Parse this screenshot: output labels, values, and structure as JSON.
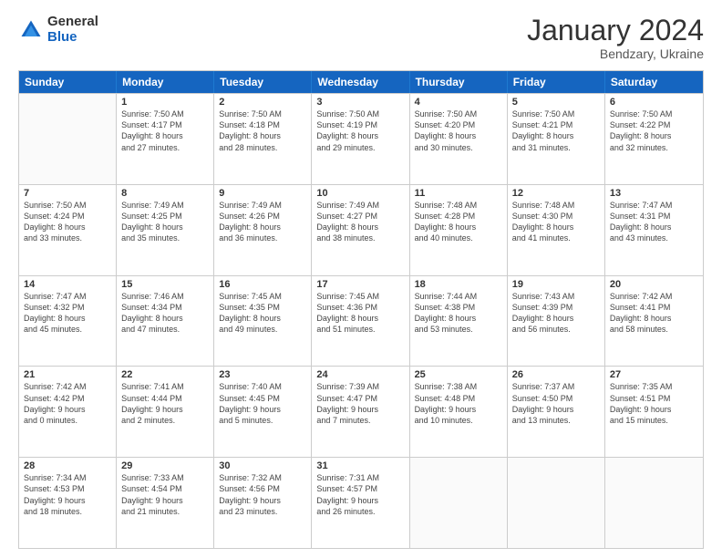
{
  "logo": {
    "general": "General",
    "blue": "Blue"
  },
  "title": "January 2024",
  "location": "Bendzary, Ukraine",
  "days_of_week": [
    "Sunday",
    "Monday",
    "Tuesday",
    "Wednesday",
    "Thursday",
    "Friday",
    "Saturday"
  ],
  "weeks": [
    [
      {
        "day": "",
        "lines": []
      },
      {
        "day": "1",
        "lines": [
          "Sunrise: 7:50 AM",
          "Sunset: 4:17 PM",
          "Daylight: 8 hours",
          "and 27 minutes."
        ]
      },
      {
        "day": "2",
        "lines": [
          "Sunrise: 7:50 AM",
          "Sunset: 4:18 PM",
          "Daylight: 8 hours",
          "and 28 minutes."
        ]
      },
      {
        "day": "3",
        "lines": [
          "Sunrise: 7:50 AM",
          "Sunset: 4:19 PM",
          "Daylight: 8 hours",
          "and 29 minutes."
        ]
      },
      {
        "day": "4",
        "lines": [
          "Sunrise: 7:50 AM",
          "Sunset: 4:20 PM",
          "Daylight: 8 hours",
          "and 30 minutes."
        ]
      },
      {
        "day": "5",
        "lines": [
          "Sunrise: 7:50 AM",
          "Sunset: 4:21 PM",
          "Daylight: 8 hours",
          "and 31 minutes."
        ]
      },
      {
        "day": "6",
        "lines": [
          "Sunrise: 7:50 AM",
          "Sunset: 4:22 PM",
          "Daylight: 8 hours",
          "and 32 minutes."
        ]
      }
    ],
    [
      {
        "day": "7",
        "lines": [
          "Sunrise: 7:50 AM",
          "Sunset: 4:24 PM",
          "Daylight: 8 hours",
          "and 33 minutes."
        ]
      },
      {
        "day": "8",
        "lines": [
          "Sunrise: 7:49 AM",
          "Sunset: 4:25 PM",
          "Daylight: 8 hours",
          "and 35 minutes."
        ]
      },
      {
        "day": "9",
        "lines": [
          "Sunrise: 7:49 AM",
          "Sunset: 4:26 PM",
          "Daylight: 8 hours",
          "and 36 minutes."
        ]
      },
      {
        "day": "10",
        "lines": [
          "Sunrise: 7:49 AM",
          "Sunset: 4:27 PM",
          "Daylight: 8 hours",
          "and 38 minutes."
        ]
      },
      {
        "day": "11",
        "lines": [
          "Sunrise: 7:48 AM",
          "Sunset: 4:28 PM",
          "Daylight: 8 hours",
          "and 40 minutes."
        ]
      },
      {
        "day": "12",
        "lines": [
          "Sunrise: 7:48 AM",
          "Sunset: 4:30 PM",
          "Daylight: 8 hours",
          "and 41 minutes."
        ]
      },
      {
        "day": "13",
        "lines": [
          "Sunrise: 7:47 AM",
          "Sunset: 4:31 PM",
          "Daylight: 8 hours",
          "and 43 minutes."
        ]
      }
    ],
    [
      {
        "day": "14",
        "lines": [
          "Sunrise: 7:47 AM",
          "Sunset: 4:32 PM",
          "Daylight: 8 hours",
          "and 45 minutes."
        ]
      },
      {
        "day": "15",
        "lines": [
          "Sunrise: 7:46 AM",
          "Sunset: 4:34 PM",
          "Daylight: 8 hours",
          "and 47 minutes."
        ]
      },
      {
        "day": "16",
        "lines": [
          "Sunrise: 7:45 AM",
          "Sunset: 4:35 PM",
          "Daylight: 8 hours",
          "and 49 minutes."
        ]
      },
      {
        "day": "17",
        "lines": [
          "Sunrise: 7:45 AM",
          "Sunset: 4:36 PM",
          "Daylight: 8 hours",
          "and 51 minutes."
        ]
      },
      {
        "day": "18",
        "lines": [
          "Sunrise: 7:44 AM",
          "Sunset: 4:38 PM",
          "Daylight: 8 hours",
          "and 53 minutes."
        ]
      },
      {
        "day": "19",
        "lines": [
          "Sunrise: 7:43 AM",
          "Sunset: 4:39 PM",
          "Daylight: 8 hours",
          "and 56 minutes."
        ]
      },
      {
        "day": "20",
        "lines": [
          "Sunrise: 7:42 AM",
          "Sunset: 4:41 PM",
          "Daylight: 8 hours",
          "and 58 minutes."
        ]
      }
    ],
    [
      {
        "day": "21",
        "lines": [
          "Sunrise: 7:42 AM",
          "Sunset: 4:42 PM",
          "Daylight: 9 hours",
          "and 0 minutes."
        ]
      },
      {
        "day": "22",
        "lines": [
          "Sunrise: 7:41 AM",
          "Sunset: 4:44 PM",
          "Daylight: 9 hours",
          "and 2 minutes."
        ]
      },
      {
        "day": "23",
        "lines": [
          "Sunrise: 7:40 AM",
          "Sunset: 4:45 PM",
          "Daylight: 9 hours",
          "and 5 minutes."
        ]
      },
      {
        "day": "24",
        "lines": [
          "Sunrise: 7:39 AM",
          "Sunset: 4:47 PM",
          "Daylight: 9 hours",
          "and 7 minutes."
        ]
      },
      {
        "day": "25",
        "lines": [
          "Sunrise: 7:38 AM",
          "Sunset: 4:48 PM",
          "Daylight: 9 hours",
          "and 10 minutes."
        ]
      },
      {
        "day": "26",
        "lines": [
          "Sunrise: 7:37 AM",
          "Sunset: 4:50 PM",
          "Daylight: 9 hours",
          "and 13 minutes."
        ]
      },
      {
        "day": "27",
        "lines": [
          "Sunrise: 7:35 AM",
          "Sunset: 4:51 PM",
          "Daylight: 9 hours",
          "and 15 minutes."
        ]
      }
    ],
    [
      {
        "day": "28",
        "lines": [
          "Sunrise: 7:34 AM",
          "Sunset: 4:53 PM",
          "Daylight: 9 hours",
          "and 18 minutes."
        ]
      },
      {
        "day": "29",
        "lines": [
          "Sunrise: 7:33 AM",
          "Sunset: 4:54 PM",
          "Daylight: 9 hours",
          "and 21 minutes."
        ]
      },
      {
        "day": "30",
        "lines": [
          "Sunrise: 7:32 AM",
          "Sunset: 4:56 PM",
          "Daylight: 9 hours",
          "and 23 minutes."
        ]
      },
      {
        "day": "31",
        "lines": [
          "Sunrise: 7:31 AM",
          "Sunset: 4:57 PM",
          "Daylight: 9 hours",
          "and 26 minutes."
        ]
      },
      {
        "day": "",
        "lines": []
      },
      {
        "day": "",
        "lines": []
      },
      {
        "day": "",
        "lines": []
      }
    ]
  ]
}
